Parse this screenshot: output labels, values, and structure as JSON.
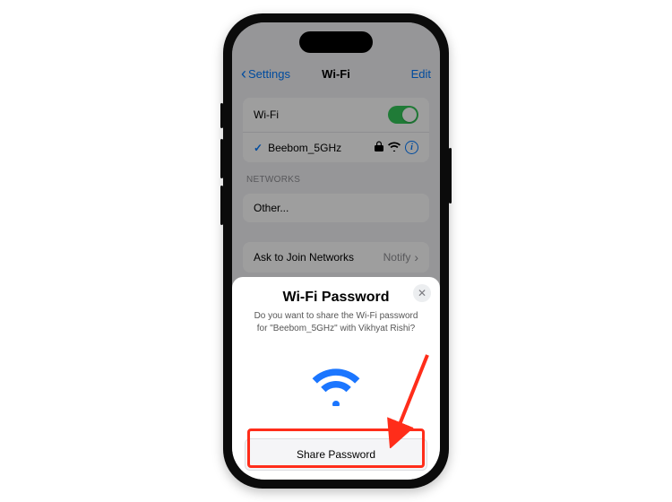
{
  "nav": {
    "back": "Settings",
    "title": "Wi-Fi",
    "edit": "Edit"
  },
  "wifi": {
    "label": "Wi-Fi",
    "enabled": true,
    "connected_network": "Beebom_5GHz"
  },
  "networks_label": "NETWORKS",
  "other_label": "Other...",
  "ask_to_join": {
    "label": "Ask to Join Networks",
    "value": "Notify"
  },
  "sheet": {
    "title": "Wi-Fi Password",
    "message": "Do you want to share the Wi-Fi password for \"Beebom_5GHz\" with Vikhyat Rishi?",
    "button": "Share Password"
  },
  "icons": {
    "back_chevron": "‹",
    "checkmark": "✓",
    "lock": "lock",
    "wifi_small": "wifi",
    "wifi_large": "wifi",
    "chevron_right": "›",
    "close": "✕"
  },
  "colors": {
    "ios_blue": "#007aff",
    "ios_green": "#34c759",
    "annotation_red": "#ff2d1a"
  }
}
